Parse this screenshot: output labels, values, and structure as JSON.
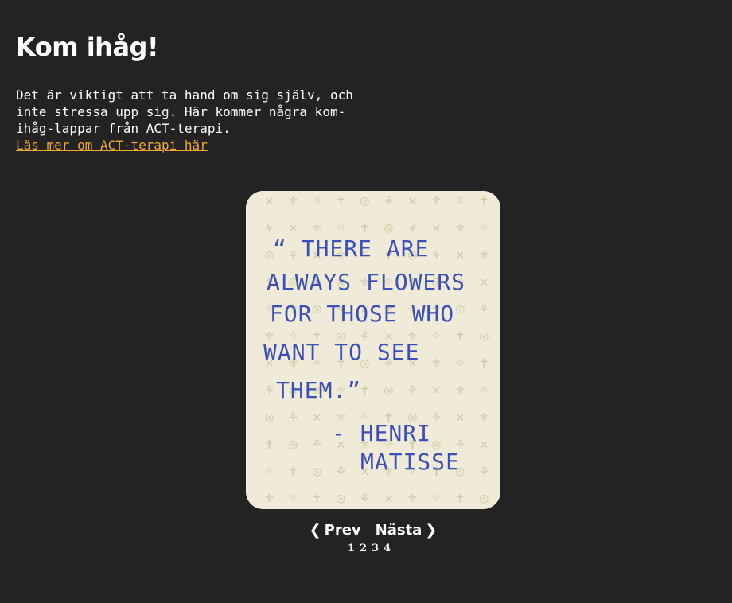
{
  "header": {
    "title": "Kom ihåg!"
  },
  "intro": {
    "text": "Det är viktigt att ta hand om sig själv, och inte stressa upp sig. Här kommer några kom-ihåg-lappar från ACT-terapi.",
    "link_label": "Läs mer om ACT-terapi här"
  },
  "card": {
    "quote_lines": [
      "“ THERE ARE",
      "ALWAYS FLOWERS",
      "FOR THOSE WHO",
      "WANT TO SEE",
      "THEM.”"
    ],
    "author_lines": [
      "- HENRI",
      "MATISSE"
    ],
    "ink_color": "#3d4fb8",
    "paper_color": "#efebd8",
    "pattern_color": "#c5c49a"
  },
  "pager": {
    "prev_label": "Prev",
    "next_label": "Nästa",
    "pages": [
      "1",
      "2",
      "3",
      "4"
    ]
  }
}
